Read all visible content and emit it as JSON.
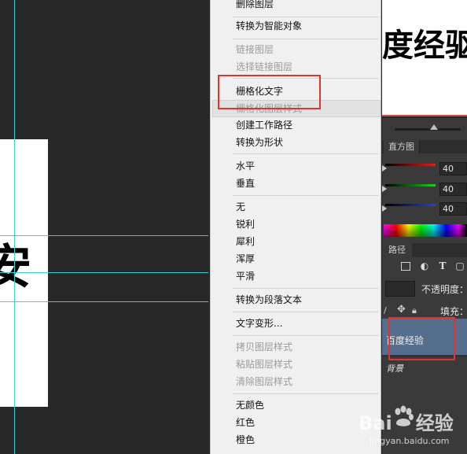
{
  "menu": {
    "items": [
      {
        "label": "删除图层",
        "disabled": false
      },
      {
        "label": "转换为智能对象",
        "disabled": false
      },
      {
        "label": "链接图层",
        "disabled": true
      },
      {
        "label": "选择链接图层",
        "disabled": true
      },
      {
        "label": "栅格化文字",
        "disabled": false
      },
      {
        "label": "栅格化图层样式",
        "disabled": true
      },
      {
        "label": "创建工作路径",
        "disabled": false
      },
      {
        "label": "转换为形状",
        "disabled": false
      },
      {
        "label": "水平",
        "disabled": false
      },
      {
        "label": "垂直",
        "disabled": false
      },
      {
        "label": "无",
        "disabled": false
      },
      {
        "label": "锐利",
        "disabled": false
      },
      {
        "label": "犀利",
        "disabled": false
      },
      {
        "label": "浑厚",
        "disabled": false
      },
      {
        "label": "平滑",
        "disabled": false
      },
      {
        "label": "转换为段落文本",
        "disabled": false
      },
      {
        "label": "文字变形...",
        "disabled": false
      },
      {
        "label": "拷贝图层样式",
        "disabled": true
      },
      {
        "label": "粘贴图层样式",
        "disabled": true
      },
      {
        "label": "清除图层样式",
        "disabled": true
      },
      {
        "label": "无颜色",
        "disabled": false
      },
      {
        "label": "红色",
        "disabled": false
      },
      {
        "label": "橙色",
        "disabled": false
      }
    ]
  },
  "document": {
    "title_text": "度经驱",
    "left_glyph": "安"
  },
  "panels": {
    "histogram_tab": "直方图",
    "rgb_values": [
      "40",
      "40",
      "40"
    ],
    "paths_tab": "路径",
    "opacity_label": "不透明度：",
    "fill_label": "填充：",
    "layer_name": "百度经验",
    "background_layer": "背景",
    "tool_icons": [
      "image-icon",
      "circle-half-icon",
      "text-tool-icon",
      "shape-icon"
    ]
  },
  "watermark": {
    "brand_left": "Bai",
    "brand_right": "经验",
    "url": "jingyan.baidu.com"
  },
  "colors": {
    "highlight": "#e0352e",
    "guide": "#39d0d8",
    "selected_layer": "#556e8e"
  }
}
